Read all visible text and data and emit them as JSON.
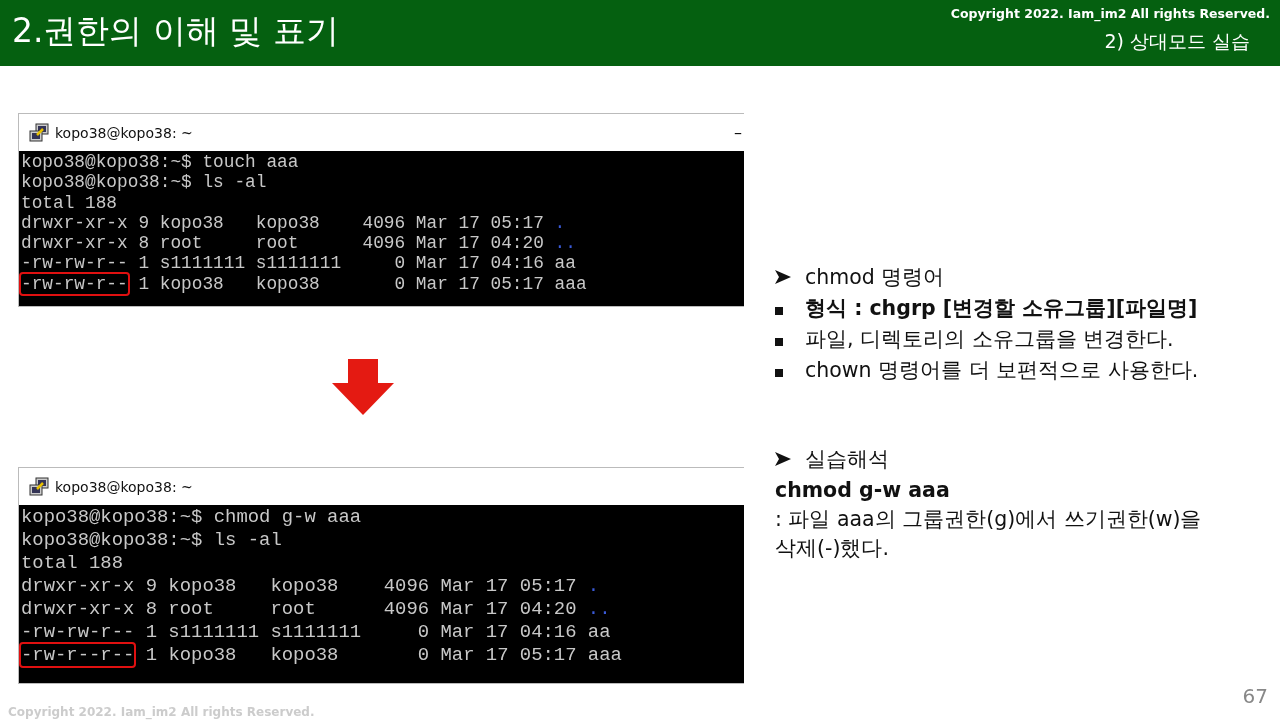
{
  "header": {
    "title": "2.권한의 이해 및 표기",
    "copyright": "Copyright 2022. Iam_im2 All rights Reserved.",
    "subtitle": "2) 상대모드 실습"
  },
  "terminals": [
    {
      "title": "kopo38@kopo38: ~",
      "minimize": "–",
      "lines": [
        [
          {
            "kind": "plain",
            "text": "kopo38@kopo38:~$ touch aaa"
          }
        ],
        [
          {
            "kind": "plain",
            "text": "kopo38@kopo38:~$ ls -al"
          }
        ],
        [
          {
            "kind": "plain",
            "text": "total 188"
          }
        ],
        [
          {
            "kind": "plain",
            "text": "drwxr-xr-x 9 kopo38   kopo38    4096 Mar 17 05:17 "
          },
          {
            "kind": "dir",
            "text": "."
          }
        ],
        [
          {
            "kind": "plain",
            "text": "drwxr-xr-x 8 root     root      4096 Mar 17 04:20 "
          },
          {
            "kind": "dir",
            "text": ".."
          }
        ],
        [
          {
            "kind": "plain",
            "text": "-rw-rw-r-- 1 s1111111 s1111111     0 Mar 17 04:16 aa"
          }
        ],
        [
          {
            "kind": "boxed",
            "text": "-rw-rw-r--"
          },
          {
            "kind": "plain",
            "text": " 1 kopo38   kopo38       0 Mar 17 05:17 aaa"
          }
        ]
      ]
    },
    {
      "title": "kopo38@kopo38: ~",
      "lines": [
        [
          {
            "kind": "plain",
            "text": "kopo38@kopo38:~$ chmod g-w aaa"
          }
        ],
        [
          {
            "kind": "plain",
            "text": "kopo38@kopo38:~$ ls -al"
          }
        ],
        [
          {
            "kind": "plain",
            "text": "total 188"
          }
        ],
        [
          {
            "kind": "plain",
            "text": "drwxr-xr-x 9 kopo38   kopo38    4096 Mar 17 05:17 "
          },
          {
            "kind": "dir",
            "text": "."
          }
        ],
        [
          {
            "kind": "plain",
            "text": "drwxr-xr-x 8 root     root      4096 Mar 17 04:20 "
          },
          {
            "kind": "dir",
            "text": ".."
          }
        ],
        [
          {
            "kind": "plain",
            "text": "-rw-rw-r-- 1 s1111111 s1111111     0 Mar 17 04:16 aa"
          }
        ],
        [
          {
            "kind": "boxed",
            "text": "-rw-r--r--"
          },
          {
            "kind": "plain",
            "text": " 1 kopo38   kopo38       0 Mar 17 05:17 aaa"
          }
        ]
      ]
    }
  ],
  "notes": [
    {
      "kind": "arrow",
      "text": "chmod 명령어"
    },
    {
      "kind": "square",
      "text": "**형식 : chgrp [변경할 소유그룹][파일명]**"
    },
    {
      "kind": "square",
      "text": "파일, 디렉토리의 소유그룹을 변경한다."
    },
    {
      "kind": "square",
      "text": "chown 명령어를 더 보편적으로 사용한다."
    }
  ],
  "practice": {
    "heading": "실습해석",
    "command": "chmod g-w aaa",
    "explanation": ": 파일 aaa의 그룹권한(g)에서 쓰기권한(w)을 삭제(-)했다."
  },
  "page_number": "67",
  "footer": "Copyright 2022. Iam_im2 All rights Reserved."
}
